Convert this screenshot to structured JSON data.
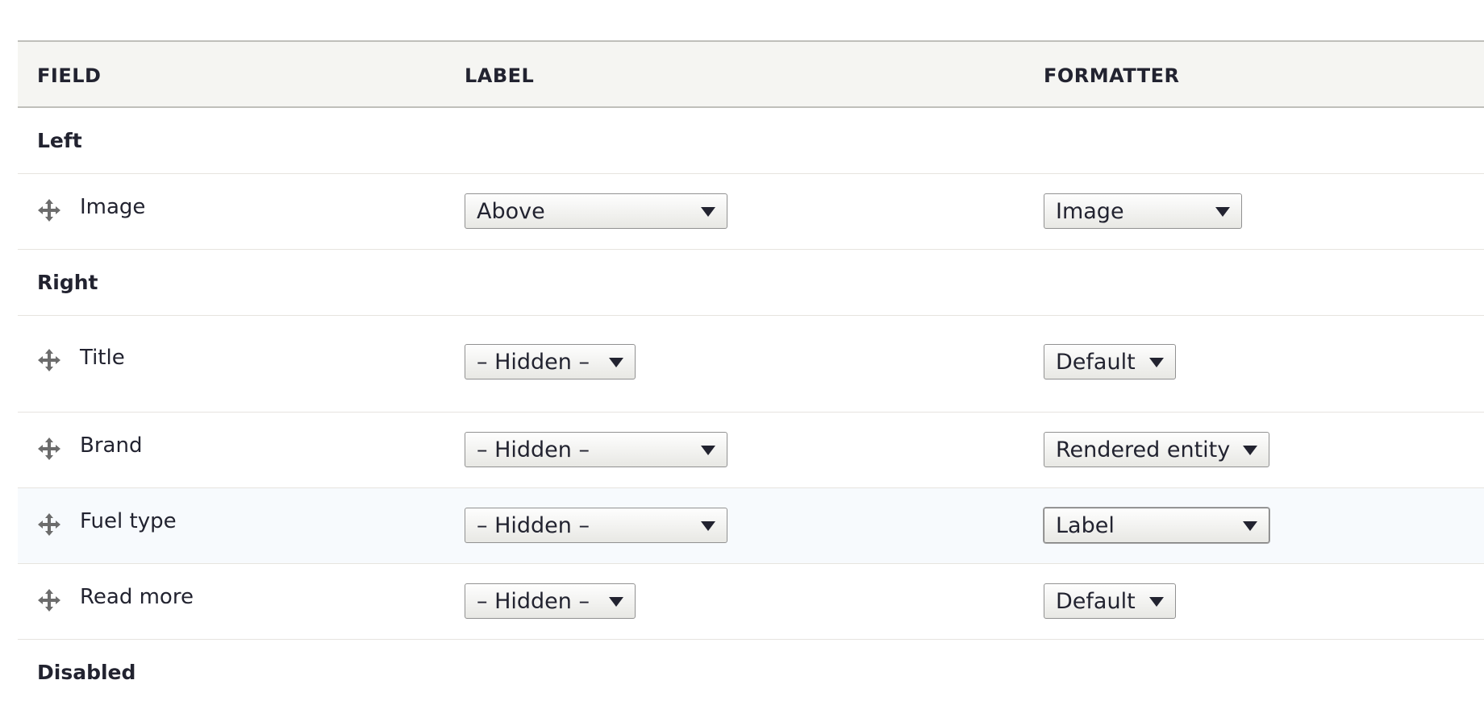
{
  "table": {
    "headers": {
      "field": "FIELD",
      "label": "LABEL",
      "formatter": "FORMATTER"
    },
    "regions": {
      "left": "Left",
      "right": "Right",
      "disabled": "Disabled"
    },
    "rows": [
      {
        "name": "Image",
        "label_select": "Above",
        "formatter_select": "Image"
      },
      {
        "name": "Title",
        "label_select": "– Hidden –",
        "formatter_select": "Default"
      },
      {
        "name": "Brand",
        "label_select": "– Hidden –",
        "formatter_select": "Rendered entity"
      },
      {
        "name": "Fuel type",
        "label_select": "– Hidden –",
        "formatter_select": "Label"
      },
      {
        "name": "Read more",
        "label_select": "– Hidden –",
        "formatter_select": "Default"
      }
    ]
  },
  "icons": {
    "drag_handle": "move-arrows-icon",
    "dropdown": "caret-down-icon"
  },
  "colors": {
    "header_bg": "#f5f5f2",
    "row_highlight": "#f7fafd",
    "border": "#bfbfba",
    "text": "#222330"
  }
}
